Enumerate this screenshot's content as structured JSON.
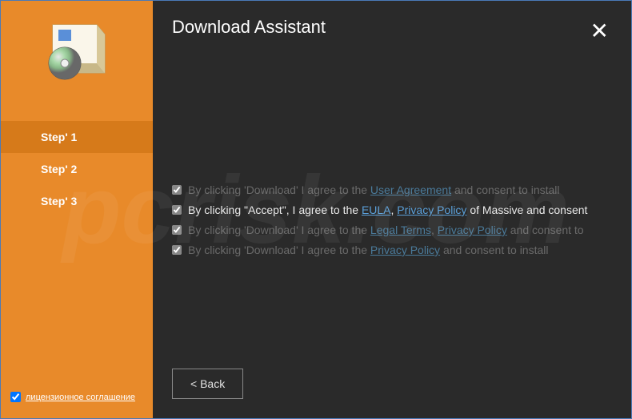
{
  "header": {
    "title": "Download Assistant",
    "close_icon": "✕"
  },
  "sidebar": {
    "steps": [
      {
        "label": "Step' 1",
        "active": true
      },
      {
        "label": "Step' 2",
        "active": false
      },
      {
        "label": "Step' 3",
        "active": false
      }
    ],
    "license": {
      "checked": true,
      "label": "лицензионное соглашение"
    }
  },
  "consent": {
    "line1_prefix": "By clicking 'Download' I agree to the ",
    "line1_link1": "User Agreement",
    "line1_suffix": " and consent to install",
    "line2_prefix": "By clicking \"Accept\", I agree to the ",
    "line2_link1": "EULA",
    "line2_sep": ", ",
    "line2_link2": "Privacy Policy",
    "line2_suffix": " of Massive and consent",
    "line3_prefix": "By clicking 'Download' I agree to the ",
    "line3_link1": "Legal Terms",
    "line3_sep": ", ",
    "line3_link2": "Privacy Policy",
    "line3_suffix": " and consent to",
    "line4_prefix": "By clicking 'Download' I agree to the ",
    "line4_link1": "Privacy Policy",
    "line4_suffix": " and consent to install"
  },
  "footer": {
    "back_label": "< Back"
  },
  "watermark": "pcrisk.com"
}
